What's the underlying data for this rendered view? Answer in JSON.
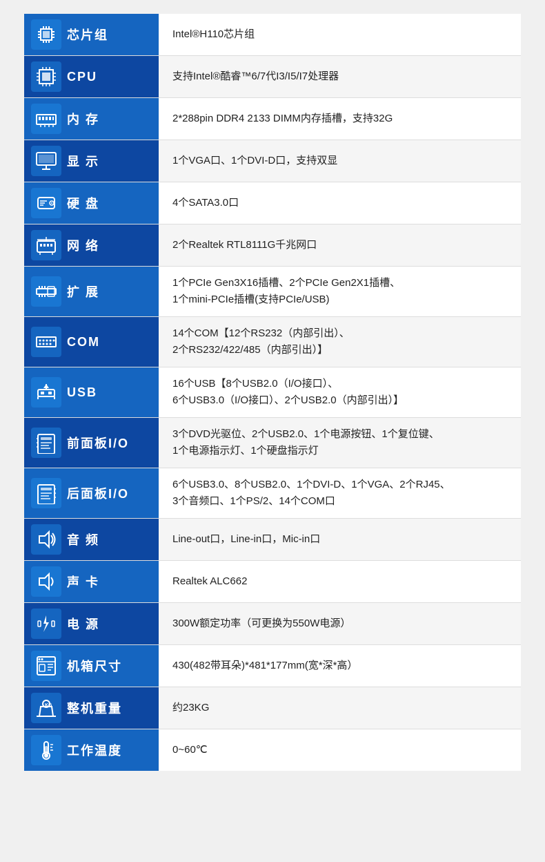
{
  "rows": [
    {
      "id": "chipset",
      "icon": "chip",
      "label": "芯片组",
      "value": "Intel®H110芯片组",
      "icon_unicode": "⬛"
    },
    {
      "id": "cpu",
      "icon": "cpu",
      "label": "CPU",
      "value": "支持Intel®酷睿™6/7代I3/I5/I7处理器",
      "icon_unicode": "▣"
    },
    {
      "id": "memory",
      "icon": "ram",
      "label": "内  存",
      "value": "2*288pin DDR4 2133 DIMM内存插槽，支持32G",
      "icon_unicode": "▬"
    },
    {
      "id": "display",
      "icon": "display",
      "label": "显  示",
      "value": "1个VGA口、1个DVI-D口，支持双显",
      "icon_unicode": "⬜"
    },
    {
      "id": "hdd",
      "icon": "hdd",
      "label": "硬  盘",
      "value": "4个SATA3.0口",
      "icon_unicode": "◎"
    },
    {
      "id": "network",
      "icon": "net",
      "label": "网  络",
      "value": "2个Realtek RTL8111G千兆网口",
      "icon_unicode": "◻"
    },
    {
      "id": "expansion",
      "icon": "expand",
      "label": "扩  展",
      "value": "1个PCIe Gen3X16插槽、2个PCIe Gen2X1插槽、\n1个mini-PCIe插槽(支持PCIe/USB)",
      "icon_unicode": "⊞"
    },
    {
      "id": "com",
      "icon": "com",
      "label": "COM",
      "value": "14个COM【12个RS232（内部引出）、\n2个RS232/422/485（内部引出）】",
      "icon_unicode": "▤"
    },
    {
      "id": "usb",
      "icon": "usb",
      "label": "USB",
      "value": "16个USB【8个USB2.0（I/O接口）、\n6个USB3.0（I/O接口）、2个USB2.0（内部引出）】",
      "icon_unicode": "⏏"
    },
    {
      "id": "front-panel",
      "icon": "front",
      "label": "前面板I/O",
      "value": "3个DVD光驱位、2个USB2.0、1个电源按钮、1个复位键、\n1个电源指示灯、1个硬盘指示灯",
      "icon_unicode": "📋"
    },
    {
      "id": "rear-panel",
      "icon": "rear",
      "label": "后面板I/O",
      "value": "6个USB3.0、8个USB2.0、1个DVI-D、1个VGA、2个RJ45、\n3个音频口、1个PS/2、14个COM口",
      "icon_unicode": "📋"
    },
    {
      "id": "audio",
      "icon": "audio",
      "label": "音  频",
      "value": "Line-out口，Line-in口，Mic-in口",
      "icon_unicode": "🔊"
    },
    {
      "id": "soundcard",
      "icon": "soundcard",
      "label": "声  卡",
      "value": "Realtek ALC662",
      "icon_unicode": "🔊"
    },
    {
      "id": "power",
      "icon": "power",
      "label": "电  源",
      "value": "300W额定功率（可更换为550W电源）",
      "icon_unicode": "⚡"
    },
    {
      "id": "case-size",
      "icon": "case",
      "label": "机箱尺寸",
      "value": "430(482带耳朵)*481*177mm(宽*深*高）",
      "icon_unicode": "🔧"
    },
    {
      "id": "weight",
      "icon": "weight",
      "label": "整机重量",
      "value": "约23KG",
      "icon_unicode": "⚖"
    },
    {
      "id": "temperature",
      "icon": "temp",
      "label": "工作温度",
      "value": "0~60℃",
      "icon_unicode": "🌡"
    }
  ],
  "colors": {
    "label_bg_odd": "#1565c0",
    "label_bg_even": "#0d47a1",
    "value_bg_odd": "#ffffff",
    "value_bg_even": "#f5f5f5",
    "text_label": "#ffffff",
    "text_value": "#222222"
  }
}
